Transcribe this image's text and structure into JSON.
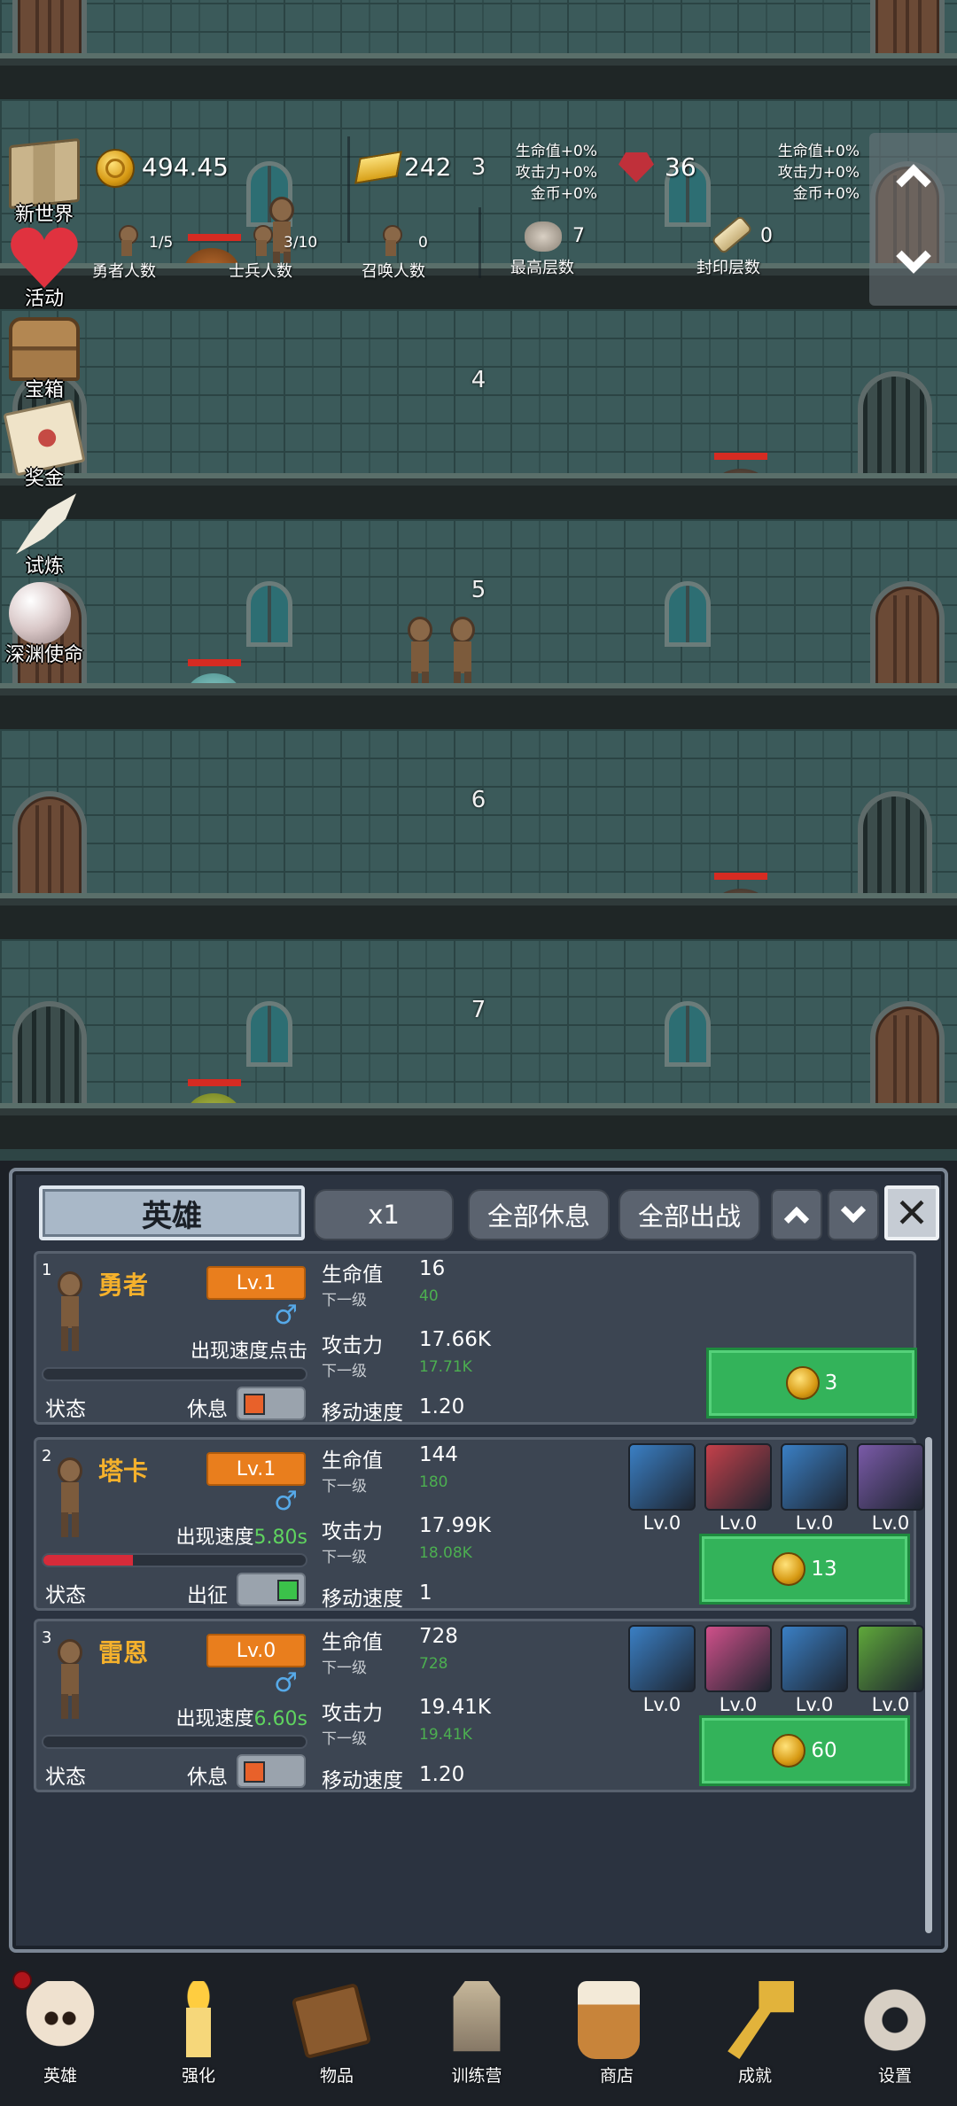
{
  "tower": {
    "floors": [
      "3",
      "4",
      "5",
      "6",
      "7"
    ]
  },
  "hud": {
    "coins": "494.45",
    "gold_bars": "242",
    "gems": "36",
    "bonus_left": {
      "hp": "生命值+0%",
      "atk": "攻击力+0%",
      "gold": "金币+0%"
    },
    "bonus_right": {
      "hp": "生命值+0%",
      "atk": "攻击力+0%",
      "gold": "金币+0%"
    },
    "heroes_count": "1/5",
    "heroes_label": "勇者人数",
    "soldiers_count": "3/10",
    "soldiers_label": "士兵人数",
    "summon_count": "0",
    "summon_label": "召唤人数",
    "max_floor": "7",
    "max_floor_label": "最高层数",
    "sealed_floor": "0",
    "sealed_floor_label": "封印层数"
  },
  "side_menu": [
    {
      "label": "新世界",
      "icon": "map-icon"
    },
    {
      "label": "活动",
      "icon": "heart-icon"
    },
    {
      "label": "宝箱",
      "icon": "chest-icon"
    },
    {
      "label": "奖金",
      "icon": "letter-icon"
    },
    {
      "label": "试炼",
      "icon": "feather-icon"
    },
    {
      "label": "深渊使命",
      "icon": "pearl-icon"
    }
  ],
  "panel": {
    "title": "英雄",
    "multiplier": "x1",
    "rest_all": "全部休息",
    "deploy_all": "全部出战"
  },
  "heroes": [
    {
      "index": "1",
      "name": "勇者",
      "level": "Lv.1",
      "gender": "♂",
      "spawn_label": "出现速度点击",
      "spawn_value": "",
      "hp_fill": 0,
      "status_label": "状态",
      "status_value": "休息",
      "deployed": false,
      "hp_label": "生命值",
      "hp": "16",
      "next_label": "下一级",
      "hp_next": "40",
      "atk_label": "攻击力",
      "atk": "17.66K",
      "atk_next": "17.71K",
      "speed_label": "移动速度",
      "speed": "1.20",
      "cost": "3",
      "equipment": []
    },
    {
      "index": "2",
      "name": "塔卡",
      "level": "Lv.1",
      "gender": "♂",
      "spawn_label": "出现速度",
      "spawn_value": "5.80s",
      "hp_fill": 0.34,
      "status_label": "状态",
      "status_value": "出征",
      "deployed": true,
      "hp_label": "生命值",
      "hp": "144",
      "next_label": "下一级",
      "hp_next": "180",
      "atk_label": "攻击力",
      "atk": "17.99K",
      "atk_next": "18.08K",
      "speed_label": "移动速度",
      "speed": "1",
      "cost": "13",
      "equipment": [
        {
          "icon": "armor-icon",
          "level": "Lv.0",
          "color": "#3a7fc4"
        },
        {
          "icon": "axe-icon",
          "level": "Lv.0",
          "color": "#c4404a"
        },
        {
          "icon": "boots-icon",
          "level": "Lv.0",
          "color": "#3a7fc4"
        },
        {
          "icon": "crossbow-icon",
          "level": "Lv.0",
          "color": "#7a5aa8"
        }
      ]
    },
    {
      "index": "3",
      "name": "雷恩",
      "level": "Lv.0",
      "gender": "♂",
      "spawn_label": "出现速度",
      "spawn_value": "6.60s",
      "hp_fill": 0,
      "status_label": "状态",
      "status_value": "休息",
      "deployed": false,
      "hp_label": "生命值",
      "hp": "728",
      "next_label": "下一级",
      "hp_next": "728",
      "atk_label": "攻击力",
      "atk": "19.41K",
      "atk_next": "19.41K",
      "speed_label": "移动速度",
      "speed": "1.20",
      "cost": "60",
      "equipment": [
        {
          "icon": "shield-icon",
          "level": "Lv.0",
          "color": "#3a7fc4"
        },
        {
          "icon": "sword-icon",
          "level": "Lv.0",
          "color": "#d0508a"
        },
        {
          "icon": "boots-icon",
          "level": "Lv.0",
          "color": "#3a7fc4"
        },
        {
          "icon": "gloves-icon",
          "level": "Lv.0",
          "color": "#5fa83a"
        }
      ]
    }
  ],
  "bottom_nav": [
    {
      "label": "英雄",
      "icon": "skull-icon"
    },
    {
      "label": "强化",
      "icon": "candle-icon"
    },
    {
      "label": "物品",
      "icon": "book-icon"
    },
    {
      "label": "训练营",
      "icon": "lantern-icon"
    },
    {
      "label": "商店",
      "icon": "mug-icon"
    },
    {
      "label": "成就",
      "icon": "key-icon"
    },
    {
      "label": "设置",
      "icon": "gear-icon"
    }
  ]
}
